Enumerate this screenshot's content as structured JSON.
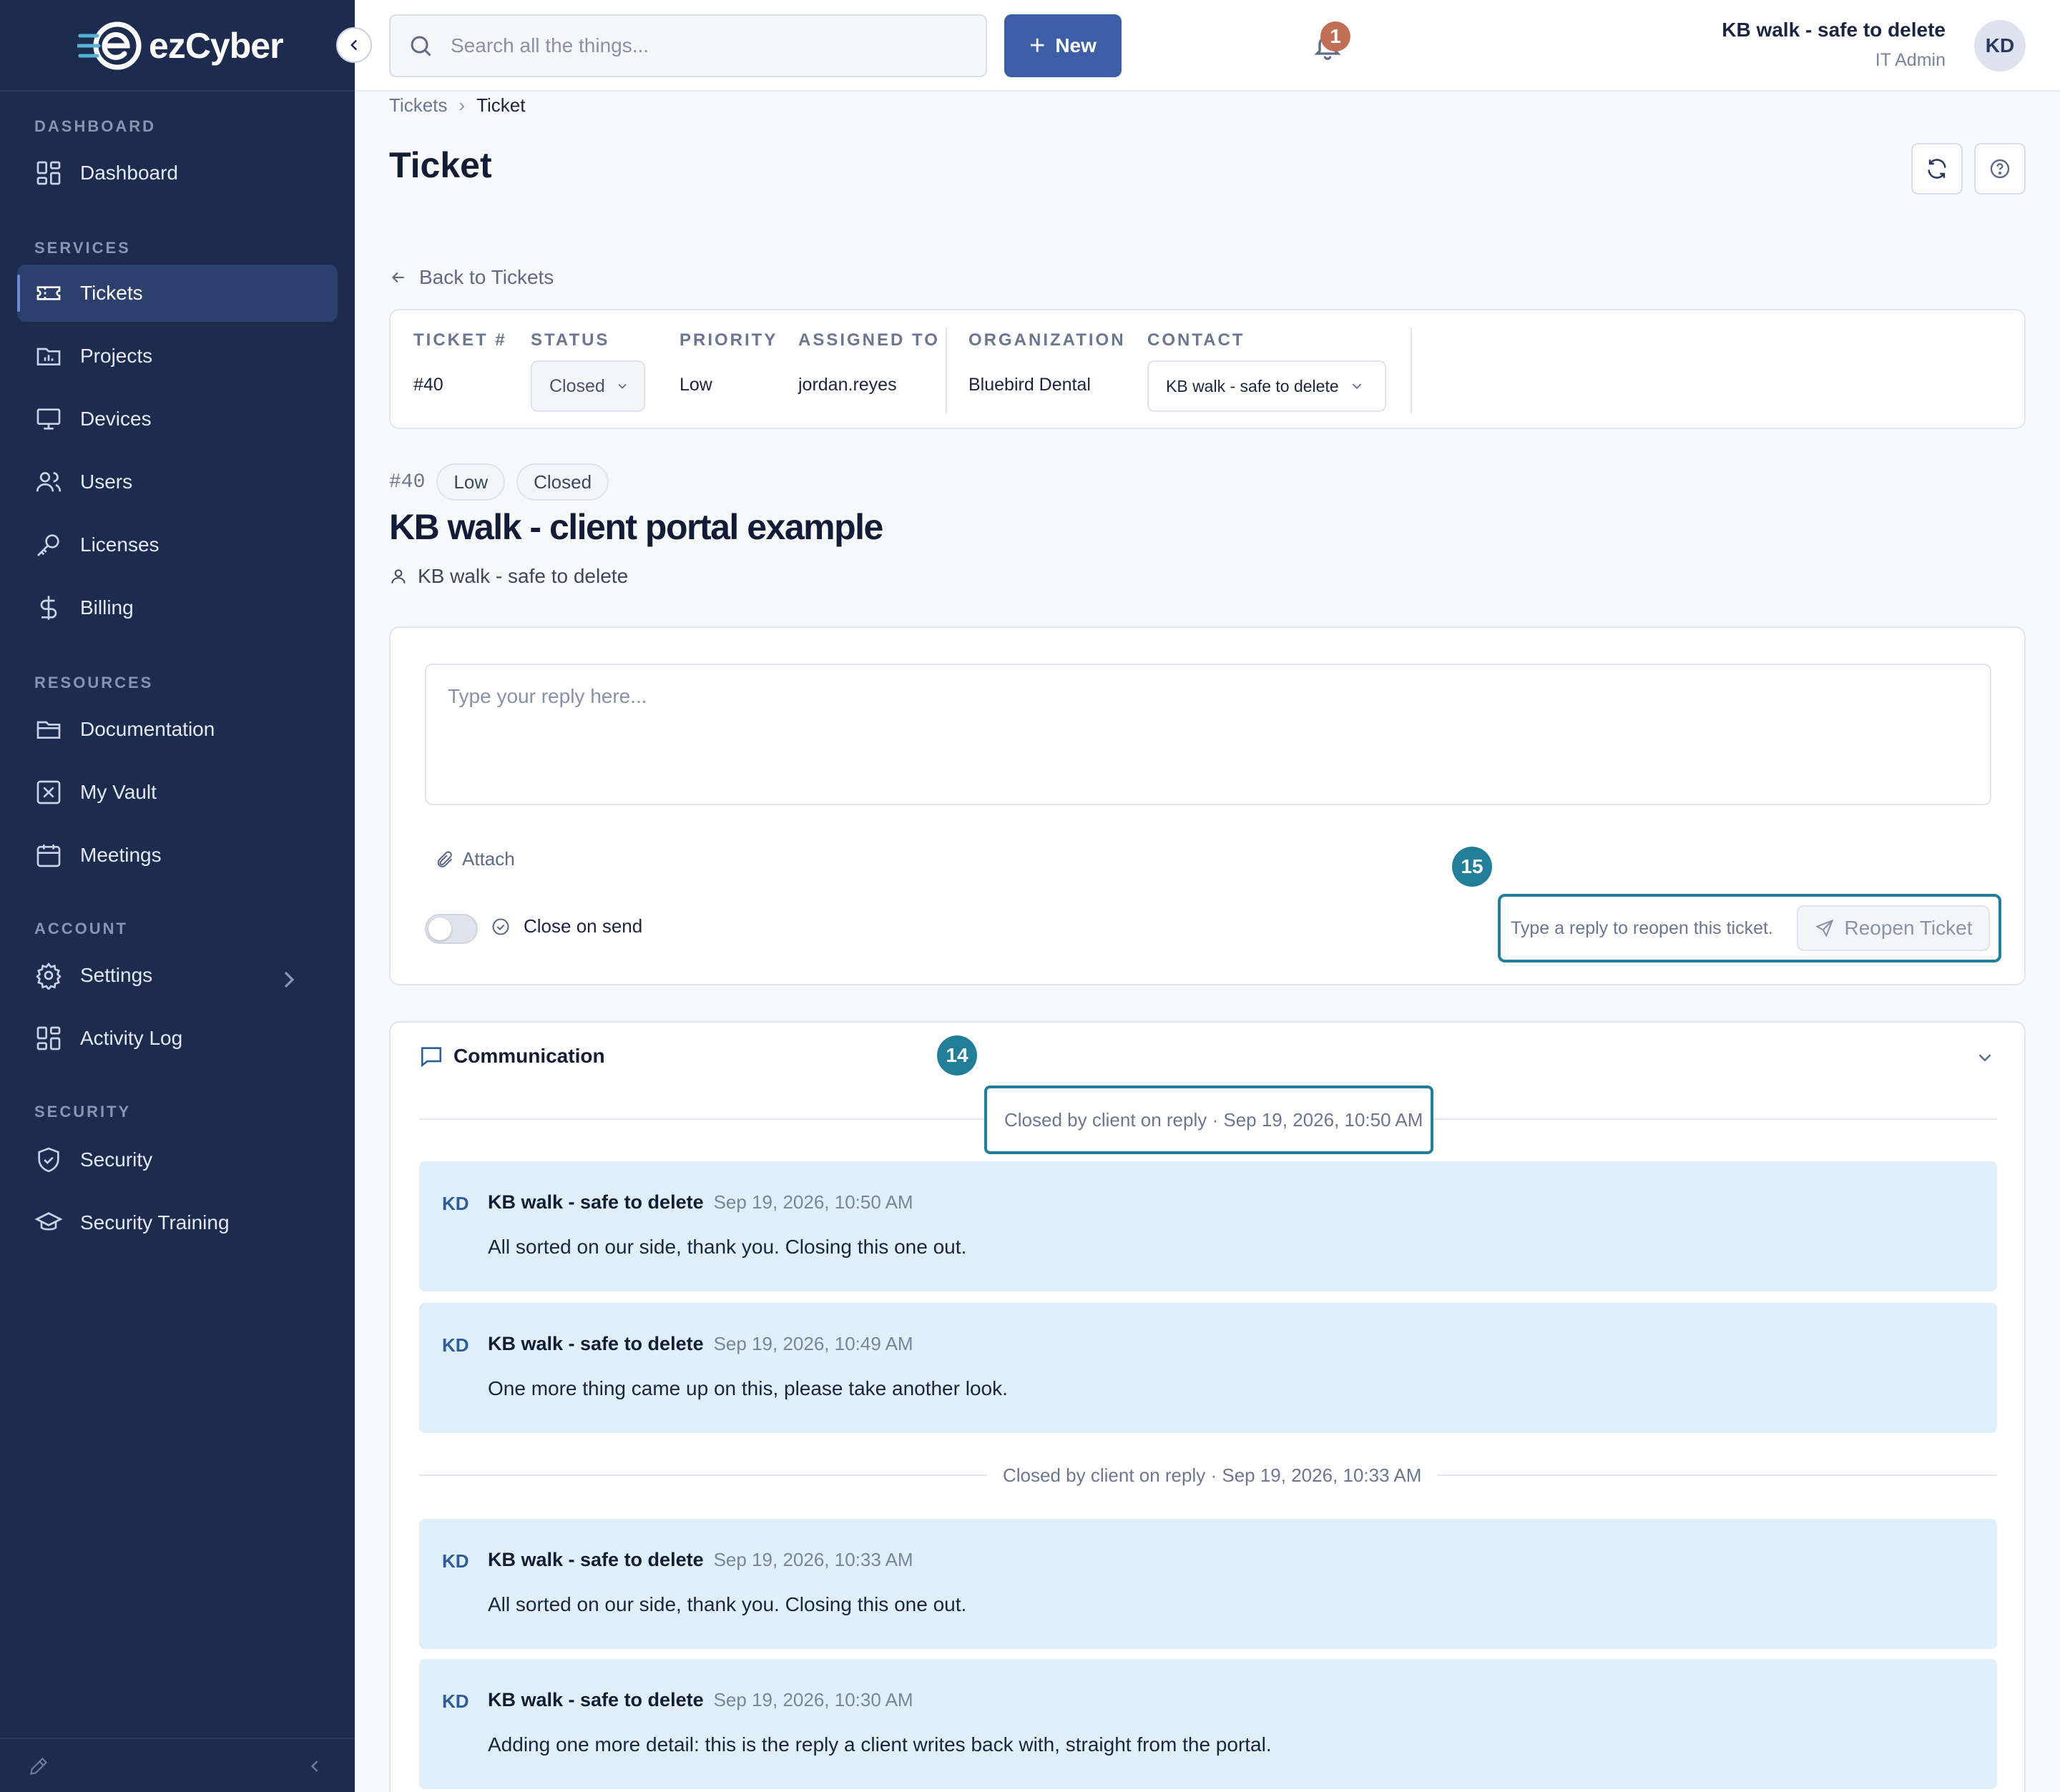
{
  "brand": {
    "name_prefix": "ez",
    "name_suffix": "Cyber",
    "accent": "#3d5fa8",
    "sidebar_bg": "#1d2b4e",
    "highlight": "#237f99"
  },
  "sidebar": {
    "sections": {
      "dashboard": "DASHBOARD",
      "services": "SERVICES",
      "resources": "RESOURCES",
      "account": "ACCOUNT",
      "security": "SECURITY"
    },
    "items": {
      "dashboard": "Dashboard",
      "tickets": "Tickets",
      "projects": "Projects",
      "devices": "Devices",
      "users": "Users",
      "licenses": "Licenses",
      "billing": "Billing",
      "documentation": "Documentation",
      "vault": "My Vault",
      "meetings": "Meetings",
      "settings": "Settings",
      "activity": "Activity Log",
      "security": "Security",
      "training": "Security Training"
    },
    "active": "Tickets"
  },
  "topbar": {
    "search_placeholder": "Search all the things...",
    "new_label": "New",
    "notification_count": "1",
    "user_name": "KB walk - safe to delete",
    "user_role": "IT Admin",
    "avatar_initials": "KD"
  },
  "breadcrumb": {
    "parent": "Tickets",
    "current": "Ticket"
  },
  "page": {
    "title": "Ticket",
    "back_label": "Back to Tickets"
  },
  "info": {
    "ticket_label": "TICKET #",
    "ticket_value": "#40",
    "status_label": "STATUS",
    "status_value": "Closed",
    "priority_label": "PRIORITY",
    "priority_value": "Low",
    "assigned_label": "ASSIGNED TO",
    "assigned_value": "jordan.reyes",
    "org_label": "ORGANIZATION",
    "org_value": "Bluebird Dental",
    "contact_label": "CONTACT",
    "contact_value": "KB walk - safe to delete"
  },
  "ticket": {
    "number": "#40",
    "priority_pill": "Low",
    "status_pill": "Closed",
    "subject": "KB walk - client portal example",
    "contact": "KB walk - safe to delete"
  },
  "reply": {
    "placeholder": "Type your reply here...",
    "attach_label": "Attach",
    "close_on_send_label": "Close on send",
    "close_on_send": false,
    "reopen_hint": "Type a reply to reopen this ticket.",
    "reopen_label": "Reopen Ticket"
  },
  "callouts": {
    "reopen": "15",
    "closed_event": "14"
  },
  "communication": {
    "title": "Communication",
    "events": [
      "Closed by client on reply · Sep 19, 2026, 10:50 AM",
      "Closed by client on reply · Sep 19, 2026, 10:33 AM"
    ],
    "messages": [
      {
        "initials": "KD",
        "author": "KB walk - safe to delete",
        "time": "Sep 19, 2026, 10:50 AM",
        "body": "All sorted on our side, thank you. Closing this one out."
      },
      {
        "initials": "KD",
        "author": "KB walk - safe to delete",
        "time": "Sep 19, 2026, 10:49 AM",
        "body": "One more thing came up on this, please take another look."
      },
      {
        "initials": "KD",
        "author": "KB walk - safe to delete",
        "time": "Sep 19, 2026, 10:33 AM",
        "body": "All sorted on our side, thank you. Closing this one out."
      },
      {
        "initials": "KD",
        "author": "KB walk - safe to delete",
        "time": "Sep 19, 2026, 10:30 AM",
        "body": "Adding one more detail: this is the reply a client writes back with, straight from the portal."
      }
    ]
  }
}
